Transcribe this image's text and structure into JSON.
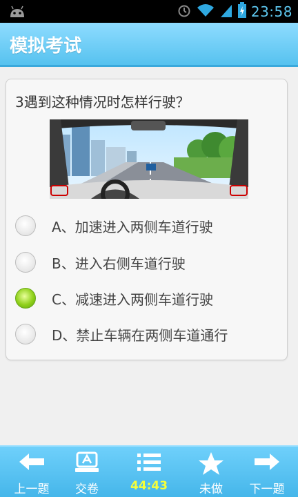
{
  "status_bar": {
    "time": "23:58"
  },
  "header": {
    "title": "模拟考试"
  },
  "question": {
    "text": "3遇到这种情况时怎样行驶？",
    "options": [
      {
        "label": "A、加速进入两侧车道行驶",
        "selected": false
      },
      {
        "label": "B、进入右侧车道行驶",
        "selected": false
      },
      {
        "label": "C、减速进入两侧车道行驶",
        "selected": true
      },
      {
        "label": "D、禁止车辆在两侧车道通行",
        "selected": false
      }
    ]
  },
  "bottom_bar": {
    "prev": "上一题",
    "submit": "交卷",
    "timer": "44:43",
    "undone": "未做",
    "next": "下一题"
  },
  "colors": {
    "accent": "#56c2ef",
    "selected_radio": "#8fd01a",
    "timer_text": "#f6ff3a"
  }
}
